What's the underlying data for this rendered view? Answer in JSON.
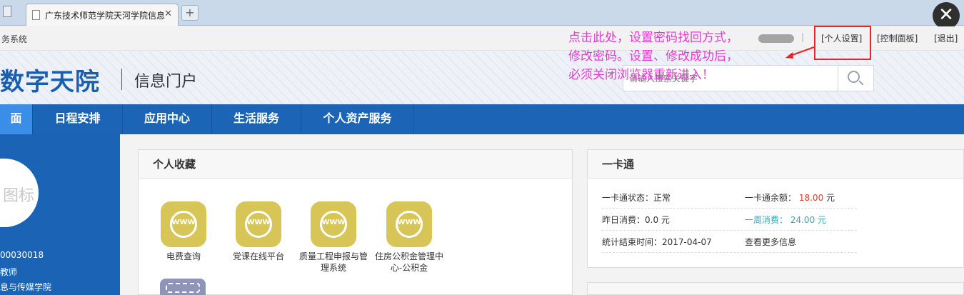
{
  "browser": {
    "tab_title": "广东技术师范学院天河学院信息",
    "tab_close": "✕",
    "new_tab": "+",
    "overlay_close": "✕"
  },
  "topbar": {
    "system_name": "务系统",
    "separator": "|",
    "links": [
      "[个人设置]",
      "[控制面板]",
      "[退出]"
    ]
  },
  "annotation": {
    "lines": [
      "点击此处，设置密码找回方式，",
      "修改密码。设置、修改成功后，",
      "必须关闭浏览器重新进入！"
    ],
    "color": "#e33bd0"
  },
  "header": {
    "brand": "数字天院",
    "portal": "信息门户",
    "search_placeholder": "请输入搜索关键字"
  },
  "nav": {
    "items": [
      "面",
      "日程安排",
      "应用中心",
      "生活服务",
      "个人资产服务"
    ]
  },
  "profile": {
    "avatar_text": "图标",
    "id": "00030018",
    "role": "教师",
    "dept": "息与传媒学院"
  },
  "favorites": {
    "title": "个人收藏",
    "apps": [
      {
        "label": "电费查询",
        "icon": "www-globe-icon"
      },
      {
        "label": "党课在线平台",
        "icon": "www-globe-icon"
      },
      {
        "label": "质量工程申报与管理系统",
        "icon": "www-globe-icon"
      },
      {
        "label": "住房公积金管理中心-公积金",
        "icon": "www-globe-icon"
      }
    ]
  },
  "card": {
    "title": "一卡通",
    "status_label": "一卡通状态：",
    "status_value": "正常",
    "balance_label": "一卡通余额：",
    "balance_value": "18.00",
    "balance_unit": "元",
    "yesterday": "昨日消费：0.0 元",
    "week_label": "一周消费：",
    "week_value": "24.00",
    "week_unit": "元",
    "stat_label": "统计结束时间：",
    "stat_value": "2017-04-07",
    "more": "查看更多信息"
  },
  "colors": {
    "nav": "#1c64b6",
    "nav_active": "#3a8ee8",
    "brand": "#1a5fae",
    "highlight_box": "#e5252a",
    "app_icon": "#d7c558"
  }
}
